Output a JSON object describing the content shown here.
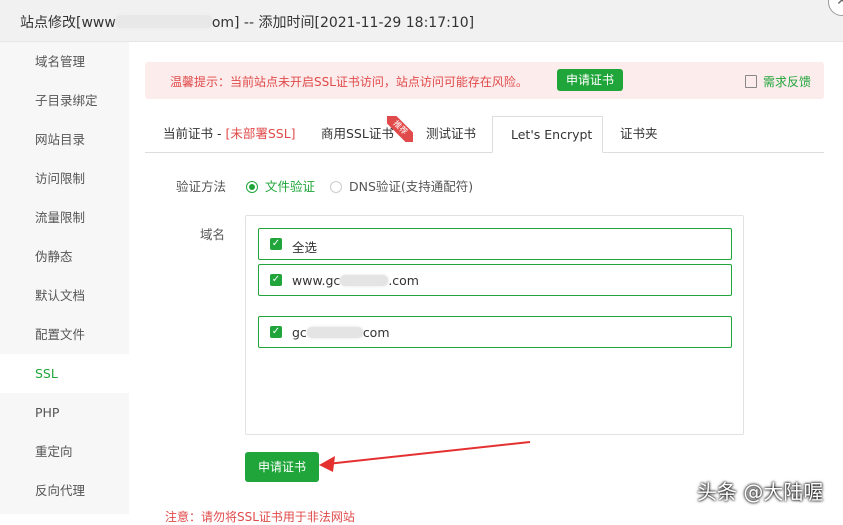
{
  "window": {
    "title_prefix": "站点修改[www",
    "title_suffix": "om] -- 添加时间[2021-11-29 18:17:10]",
    "close_label": "✕"
  },
  "sidebar": {
    "items": [
      {
        "label": "域名管理",
        "active": false
      },
      {
        "label": "子目录绑定",
        "active": false
      },
      {
        "label": "网站目录",
        "active": false
      },
      {
        "label": "访问限制",
        "active": false
      },
      {
        "label": "流量限制",
        "active": false
      },
      {
        "label": "伪静态",
        "active": false
      },
      {
        "label": "默认文档",
        "active": false
      },
      {
        "label": "配置文件",
        "active": false
      },
      {
        "label": "SSL",
        "active": true
      },
      {
        "label": "PHP",
        "active": false
      },
      {
        "label": "重定向",
        "active": false
      },
      {
        "label": "反向代理",
        "active": false
      }
    ]
  },
  "alert": {
    "text": "温馨提示：当前站点未开启SSL证书访问，站点访问可能存在风险。",
    "button": "申请证书",
    "feedback": "需求反馈"
  },
  "tabs": {
    "current_cert_prefix": "当前证书 - ",
    "current_cert_status": "[未部署SSL]",
    "commercial": "商用SSL证书",
    "ribbon": "推荐",
    "test": "测试证书",
    "letsencrypt": "Let's Encrypt",
    "cert_folder": "证书夹",
    "active": "Let's Encrypt"
  },
  "form": {
    "verify_label": "验证方法",
    "file_verify": "文件验证",
    "dns_verify": "DNS验证(支持通配符)",
    "selected_method": "文件验证",
    "domain_label": "域名",
    "select_all": "全选",
    "domain1_prefix": "www.gc",
    "domain1_suffix": ".com",
    "domain2_prefix": "gc",
    "domain2_suffix": "com",
    "check_mark": "✓",
    "apply_button": "申请证书"
  },
  "notice": {
    "text": "注意：请勿将SSL证书用于非法网站"
  },
  "watermark": {
    "text": "头条 @大陆喔"
  },
  "colors": {
    "accent": "#20a53a",
    "danger": "#e04a4a",
    "alert_bg": "#fdecec"
  }
}
